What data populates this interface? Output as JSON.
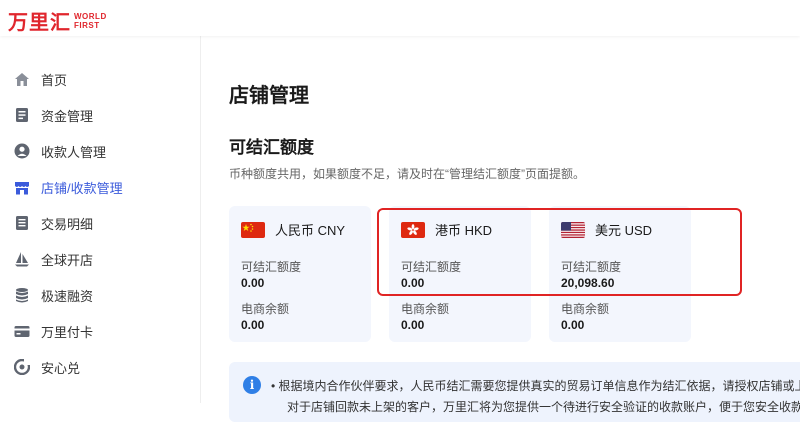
{
  "brand": {
    "name_cn": "万里汇",
    "name_en_1": "WORLD",
    "name_en_2": "FIRST",
    "color": "#e0262d"
  },
  "sidebar": {
    "items": [
      {
        "label": "首页",
        "icon": "home-icon"
      },
      {
        "label": "资金管理",
        "icon": "document-icon"
      },
      {
        "label": "收款人管理",
        "icon": "person-icon"
      },
      {
        "label": "店铺/收款管理",
        "icon": "store-icon",
        "active": true
      },
      {
        "label": "交易明细",
        "icon": "list-icon"
      },
      {
        "label": "全球开店",
        "icon": "sail-icon"
      },
      {
        "label": "极速融资",
        "icon": "coins-icon"
      },
      {
        "label": "万里付卡",
        "icon": "card-icon"
      },
      {
        "label": "安心兑",
        "icon": "exchange-icon"
      }
    ],
    "active_color": "#3b5bdb"
  },
  "main": {
    "title": "店铺管理",
    "section_title": "可结汇额度",
    "section_desc": "币种额度共用，如果额度不足，请及时在“管理结汇额度”页面提额。",
    "cards": [
      {
        "currency": "人民币 CNY",
        "flag": "china-flag-icon",
        "quota_label": "可结汇额度",
        "quota_value": "0.00",
        "balance_label": "电商余额",
        "balance_value": "0.00"
      },
      {
        "currency": "港币 HKD",
        "flag": "hongkong-flag-icon",
        "quota_label": "可结汇额度",
        "quota_value": "0.00",
        "balance_label": "电商余额",
        "balance_value": "0.00"
      },
      {
        "currency": "美元 USD",
        "flag": "usa-flag-icon",
        "quota_label": "可结汇额度",
        "quota_value": "20,098.60",
        "balance_label": "电商余额",
        "balance_value": "0.00"
      }
    ],
    "notice": {
      "icon": "info-icon",
      "text": "• 根据境内合作伙伴要求，人民币结汇需要您提供真实的贸易订单信息作为结汇依据，请授权店铺或上",
      "text2": "对于店铺回款未上架的客户，万里汇将为您提供一个待进行安全验证的收款账户，便于您安全收款并"
    },
    "highlight_color": "#e02424"
  }
}
